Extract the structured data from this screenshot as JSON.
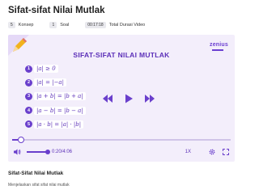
{
  "page_title": "Sifat-sifat Nilai Mutlak",
  "meta": {
    "konsep_count": "5",
    "konsep_label": "Konsep",
    "soal_count": "1",
    "soal_label": "Soal",
    "duration": "00:17:18",
    "duration_label": "Total Durasi Video"
  },
  "player": {
    "logo": "zenius",
    "heading": "SIFAT-SIFAT NILAI MUTLAK",
    "properties": [
      {
        "num": "1",
        "formula": "|a| ≥ 0"
      },
      {
        "num": "2",
        "formula": "|a| = |−a|"
      },
      {
        "num": "3",
        "formula": "|a + b| = |b + a|"
      },
      {
        "num": "4",
        "formula": "|a − b| = |b − a|"
      },
      {
        "num": "5",
        "formula": "|a · b| = |a| · |b|"
      }
    ],
    "progress": 0.042,
    "time": "0:20/4:06",
    "speed": "1X"
  },
  "video": {
    "title": "Sifat-Sifat Nilai Mutlak",
    "description": "Menjelaskan sifat sifat nilai mutlak"
  },
  "colors": {
    "accent": "#6a3fcc",
    "player_bg": "#f3eefb"
  },
  "icons": [
    "pencil-icon",
    "rewind-icon",
    "play-icon",
    "fast-forward-icon",
    "volume-icon",
    "settings-icon",
    "fullscreen-icon"
  ]
}
